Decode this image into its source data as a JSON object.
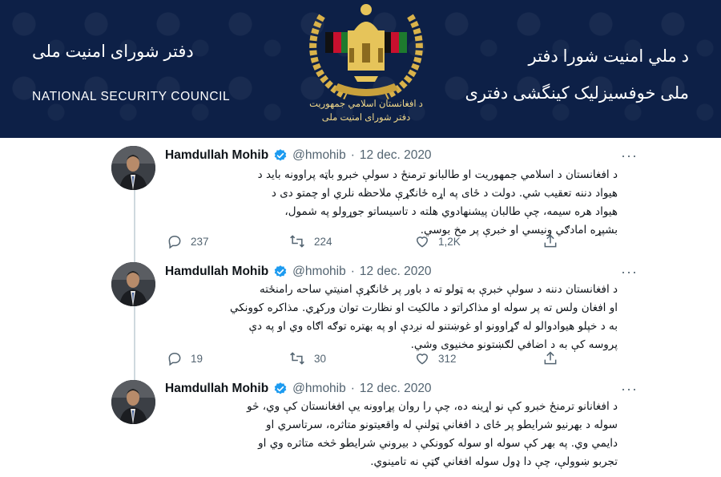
{
  "banner": {
    "left_pashto": "دفتر شورای امنیت ملی",
    "left_english": "NATIONAL SECURITY COUNCIL",
    "right_line1": "د ملي امنیت شورا دفتر",
    "right_line2": "ملی خوفسيزليک کينگشی دفتری",
    "emblem_caption1": "د افغانستان اسلامي جمهوريت",
    "emblem_caption2": "دفتر شورای امنیت ملی",
    "emblem_icon": "afghanistan-national-emblem"
  },
  "colors": {
    "banner": "#0d2047",
    "verified": "#1d9bf0",
    "muted": "#536471"
  },
  "tweets": [
    {
      "name": "Hamdullah Mohib",
      "handle": "@hmohib",
      "dot": "·",
      "date": "12 dec. 2020",
      "more": "···",
      "lines": [
        "د افغانستان د اسلامي جمهوریت او طالبانو ترمنځ د سولې خبرو باټه پراوونه باید د",
        "هیواد دننه تعقیب شي. دولت د ځای په اړه ځانګړې ملاحظه نلري او چمتو دی د",
        "هیواد هره سیمه، چې طالبان پیشنهادوي هلته د تاسیساتو جوړولو په شمول،",
        "بشپړه امادګي ونیسي او خبرې پر مخ بوسي."
      ],
      "replies": "237",
      "retweets": "224",
      "likes": "1,2K"
    },
    {
      "name": "Hamdullah Mohib",
      "handle": "@hmohib",
      "dot": "·",
      "date": "12 dec. 2020",
      "more": "···",
      "lines": [
        "د افغانستان دننه د سولې خبرې به ټولو ته د باور پر ځانګړې امنیتي ساحه رامنځته",
        "او افغان ولس ته پر سوله او مذاکراتو د مالکیت او نظارت توان ورکړي. مذاکره کوونکي",
        "به د خپلو هیوادوالو له ګړاوونو او غوښتنو له نږدې او په بهتره توګه اګاه وي او په دې",
        "پروسه کې به د اضافي لګښتونو مخنیوی وشي."
      ],
      "replies": "19",
      "retweets": "30",
      "likes": "312"
    },
    {
      "name": "Hamdullah Mohib",
      "handle": "@hmohib",
      "dot": "·",
      "date": "12 dec. 2020",
      "more": "···",
      "lines": [
        "د افغانانو ترمنځ خبرو کې نو اړینه ده، چې را روان پړاوونه یې افغانستان کې وي، څو",
        "سوله د بهرنیو شرایطو پر ځای د افغاني ټولنې له واقعیتونو متاثره، سرتاسري او",
        "دایمي وي. په بهر کې سوله او سوله کوونکي د بیروني شرایطو څخه متاثره وي او",
        "تجربو ښوولې، چې دا ډول سوله افغاني ګټې نه تامینوي."
      ],
      "replies": "",
      "retweets": "",
      "likes": ""
    }
  ]
}
